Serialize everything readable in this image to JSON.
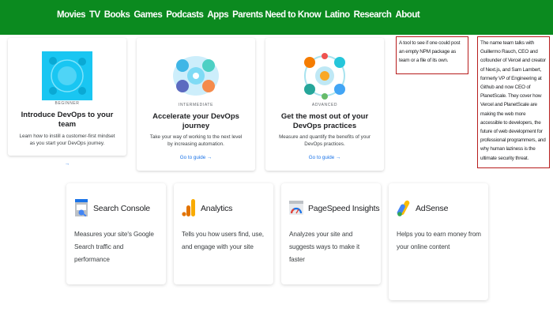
{
  "nav": {
    "items": [
      "Movies",
      "TV",
      "Books",
      "Games",
      "Podcasts",
      "Apps",
      "Parents Need to Know",
      "Latino",
      "Research",
      "About"
    ]
  },
  "devops_cards": [
    {
      "level": "BEGINNER",
      "title": "Introduce DevOps to your team",
      "description": "Learn how to instill a customer-first mindset as you start your DevOps journey.",
      "link": "→"
    },
    {
      "level": "INTERMEDIATE",
      "title": "Accelerate your DevOps journey",
      "description": "Take your way of working to the next level by increasing automation.",
      "link": "Go to guide →"
    },
    {
      "level": "ADVANCED",
      "title": "Get the most out of your DevOps practices",
      "description": "Measure and quantify the benefits of your DevOps practices.",
      "link": "Go to guide →"
    }
  ],
  "notes": {
    "small": "A tool to see if one could post an empty NPM package as team or a file of its own.",
    "large": "The name team talks with Guillermo Rauch, CEO and cofounder of Vercel and creator of Next.js, and Sam Lambert, formerly VP of Engineering at Github and now CEO of PlanetScale. They cover how Vercel and PlanetScale are making the web more accessible to developers, the future of web development for professional programmers, and why human laziness is the ultimate security threat."
  },
  "google_cards": [
    {
      "icon": "search-console-icon",
      "title": "Search Console",
      "description": "Measures your site's Google Search traffic and performance"
    },
    {
      "icon": "analytics-icon",
      "title": "Analytics",
      "description": "Tells you how users find, use, and engage with your site"
    },
    {
      "icon": "pagespeed-icon",
      "title": "PageSpeed Insights",
      "description": "Analyzes your site and suggests ways to make it faster"
    },
    {
      "icon": "adsense-icon",
      "title": "AdSense",
      "description": "Helps you to earn money from your online content"
    }
  ],
  "colors": {
    "nav_bg": "#0b8a1f",
    "link": "#1a73e8",
    "note_border": "#b71c1c"
  }
}
